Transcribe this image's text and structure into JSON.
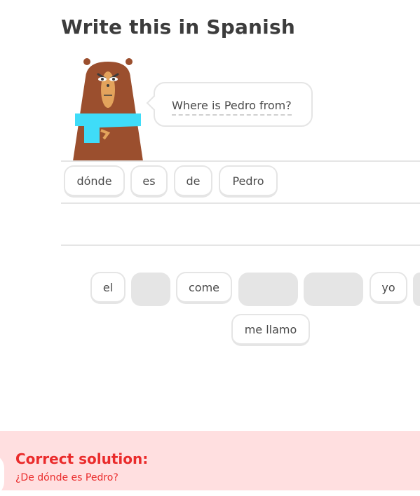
{
  "header": {
    "title": "Write this in Spanish"
  },
  "prompt": {
    "sentence": "Where is Pedro from?"
  },
  "answer_tiles": [
    "dónde",
    "es",
    "de",
    "Pedro"
  ],
  "word_bank": {
    "row1": [
      "el",
      "",
      "come",
      "",
      "",
      "yo",
      ""
    ],
    "row2": [
      "me llamo"
    ]
  },
  "feedback": {
    "heading": "Correct solution:",
    "solution": "¿De dónde es Pedro?"
  },
  "colors": {
    "error": "#ea2b2b",
    "error_bg": "#ffdfe0",
    "border": "#e5e5e5",
    "scarf": "#3fdcf8",
    "bear": "#9b4f2e"
  }
}
